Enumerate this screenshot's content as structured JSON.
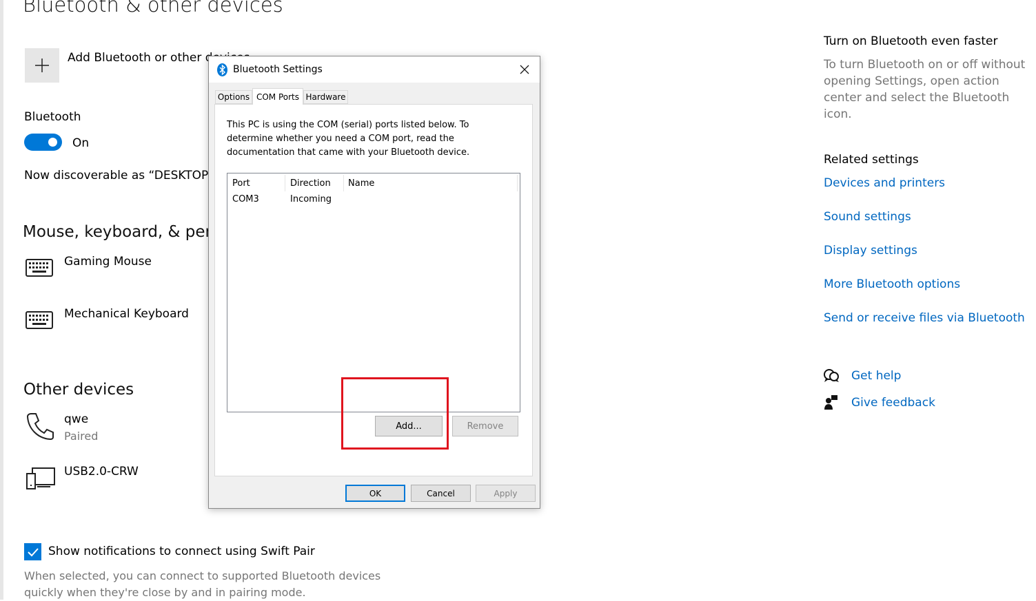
{
  "settings": {
    "page_title": "Bluetooth & other devices",
    "add_device_label": "Add Bluetooth or other devices",
    "bluetooth_heading": "Bluetooth",
    "bluetooth_toggle_state": "On",
    "discoverable_text": "Now discoverable as “DESKTOP-UE",
    "mouse_section_title": "Mouse, keyboard, & pen",
    "mouse_devices": [
      {
        "name": "Gaming Mouse",
        "icon": "keyboard-icon"
      },
      {
        "name": "Mechanical Keyboard",
        "icon": "keyboard-icon"
      }
    ],
    "other_section_title": "Other devices",
    "other_devices": [
      {
        "name": "qwe",
        "status": "Paired",
        "icon": "phone-icon"
      },
      {
        "name": "USB2.0-CRW",
        "status": "",
        "icon": "device-icon"
      }
    ],
    "swift_pair_label": "Show notifications to connect using Swift Pair",
    "swift_pair_checked": true,
    "swift_pair_desc": "When selected, you can connect to supported Bluetooth devices quickly when they're close by and in pairing mode."
  },
  "sidebar": {
    "tip_title": "Turn on Bluetooth even faster",
    "tip_text": "To turn Bluetooth on or off without opening Settings, open action center and select the Bluetooth icon.",
    "related_title": "Related settings",
    "links": [
      "Devices and printers",
      "Sound settings",
      "Display settings",
      "More Bluetooth options",
      "Send or receive files via Bluetooth"
    ],
    "help_label": "Get help",
    "feedback_label": "Give feedback"
  },
  "dialog": {
    "title": "Bluetooth Settings",
    "tabs": [
      "Options",
      "COM Ports",
      "Hardware"
    ],
    "active_tab": "COM Ports",
    "description": "This PC is using the COM (serial) ports listed below. To determine whether you need a COM port, read the documentation that came with your Bluetooth device.",
    "columns": [
      "Port",
      "Direction",
      "Name"
    ],
    "rows": [
      {
        "port": "COM3",
        "direction": "Incoming",
        "name": ""
      }
    ],
    "add_button": "Add...",
    "remove_button": "Remove",
    "ok_button": "OK",
    "cancel_button": "Cancel",
    "apply_button": "Apply"
  },
  "colors": {
    "accent": "#0078d7",
    "link": "#0067c0",
    "highlight_box": "#e0141e"
  }
}
